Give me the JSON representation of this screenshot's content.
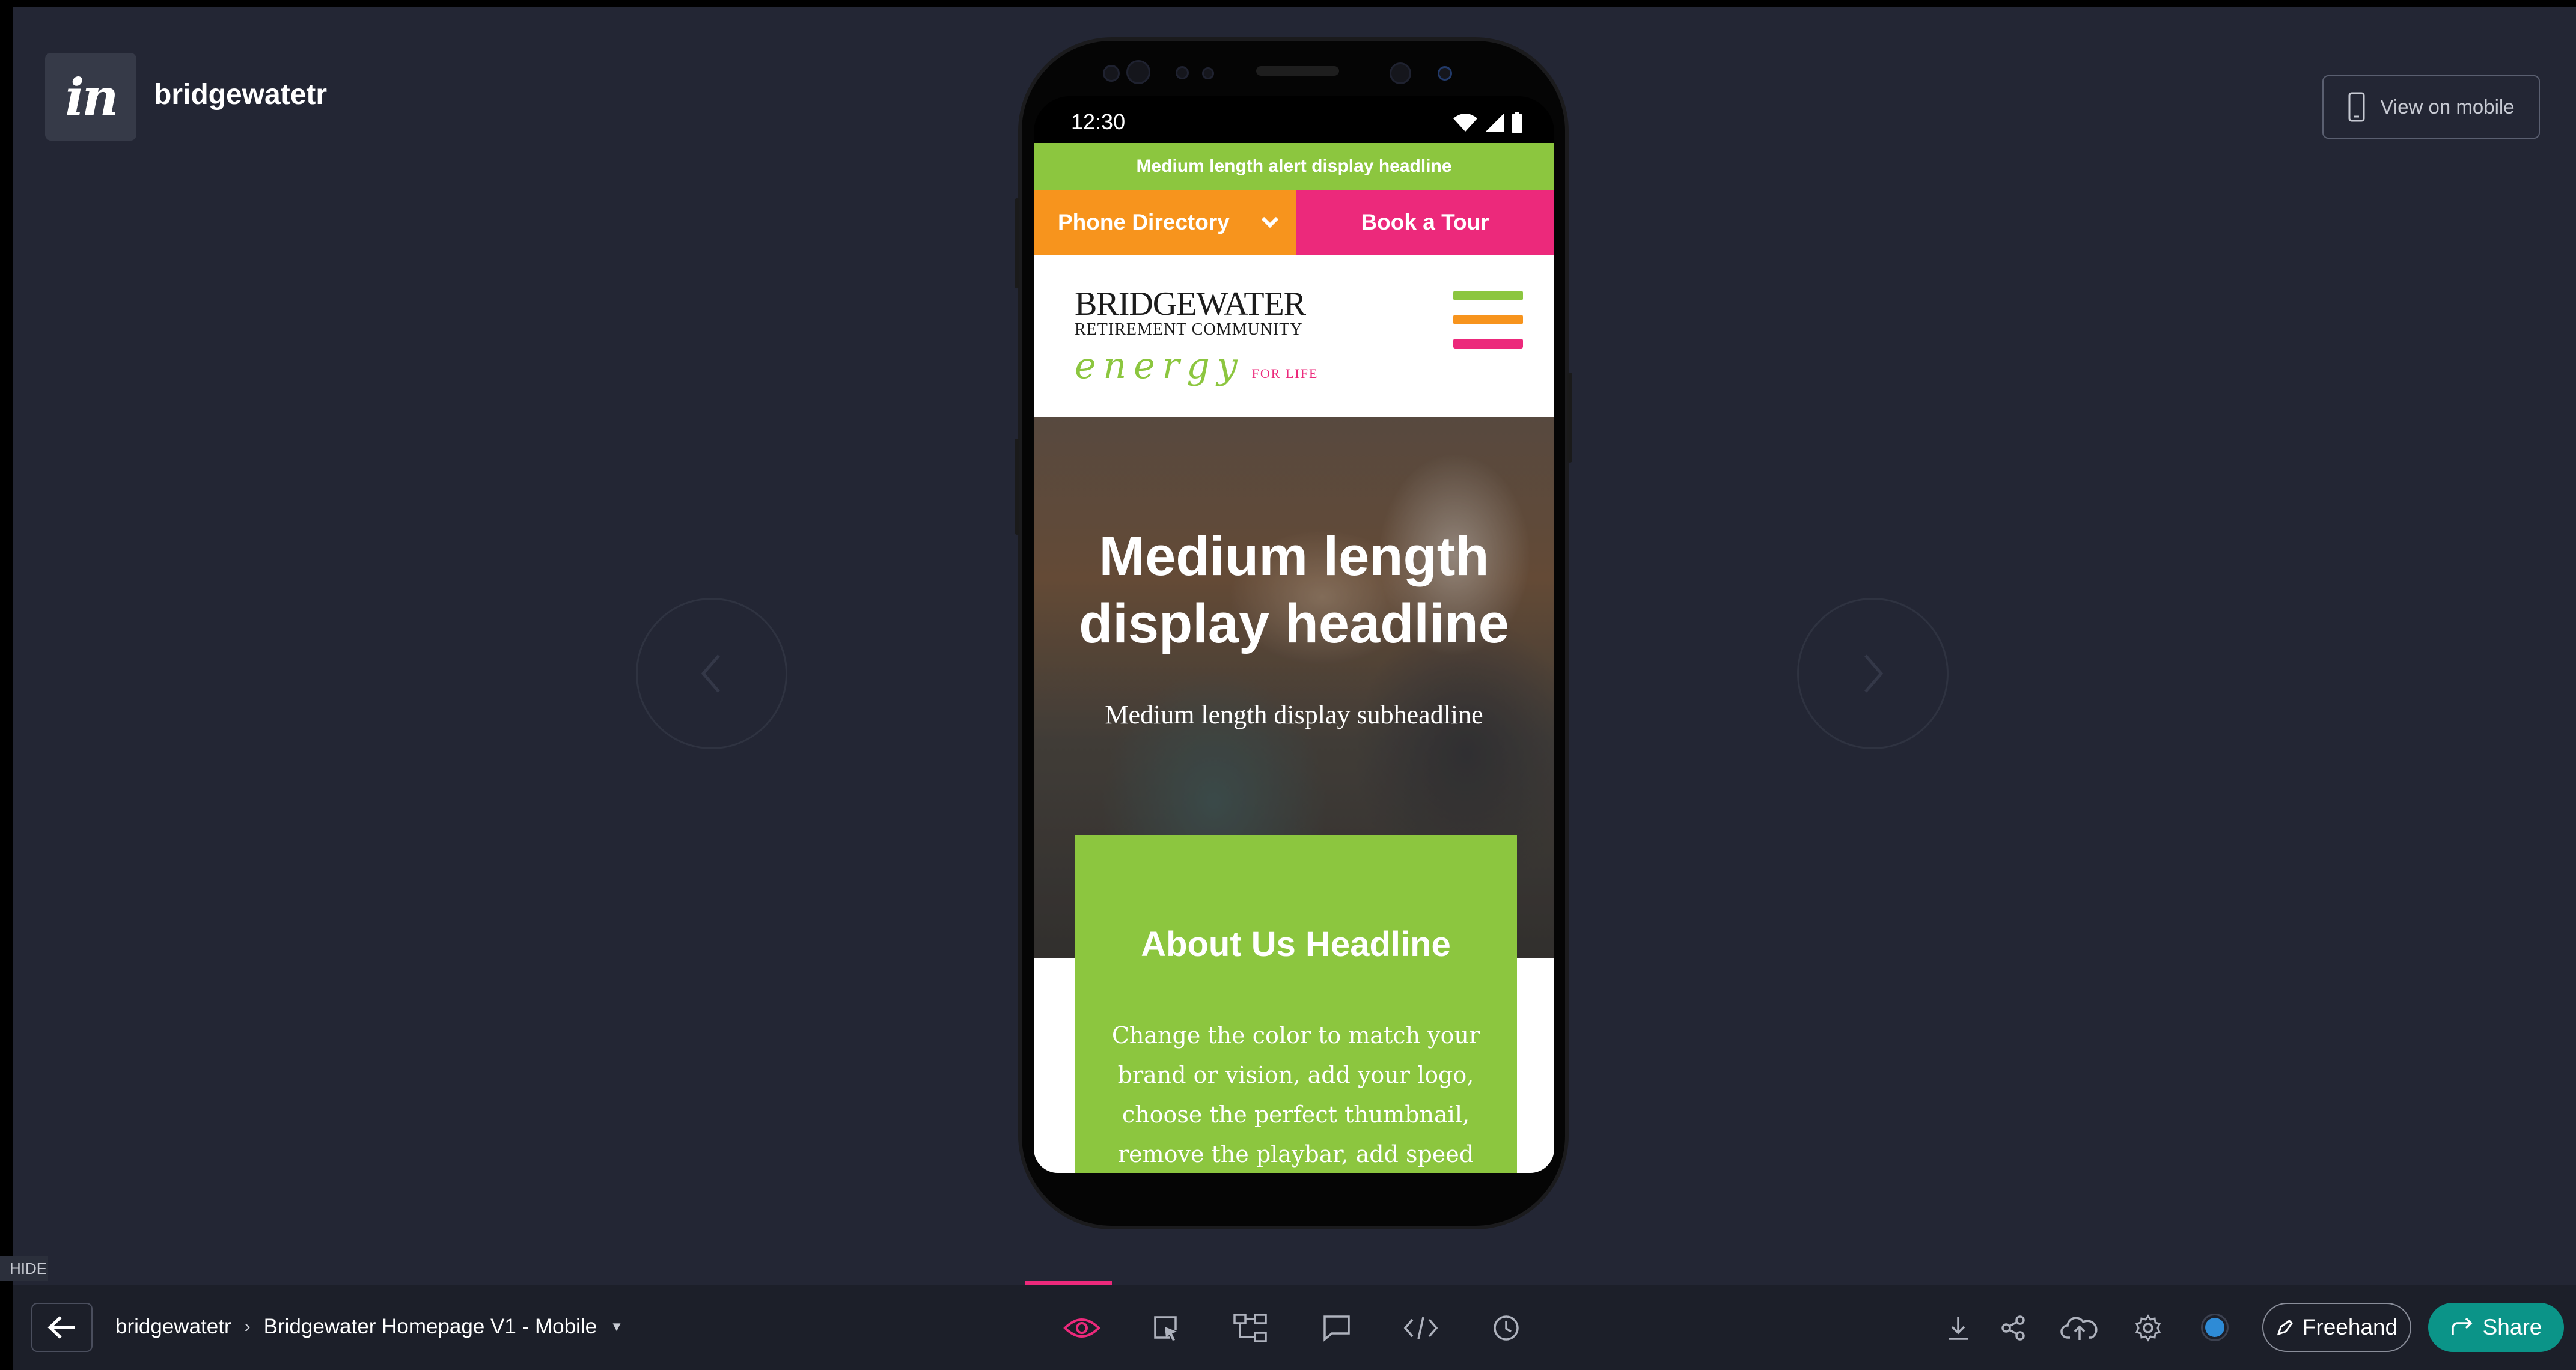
{
  "app": {
    "project_name": "bridgewatetr",
    "logo_text": "in",
    "view_on_mobile_label": "View on mobile",
    "hide_label": "HIDE"
  },
  "breadcrumb": {
    "project": "bridgewatetr",
    "screen": "Bridgewater Homepage V1 - Mobile"
  },
  "toolbar": {
    "tools": [
      "preview-icon",
      "inspect-icon",
      "flow-icon",
      "comment-icon",
      "code-icon",
      "history-icon"
    ],
    "active_tool": "preview-icon",
    "freehand_label": "Freehand",
    "share_label": "Share",
    "accent_color": "#ec297b",
    "share_color": "#0b9488"
  },
  "phone": {
    "status_time": "12:30",
    "status_icons": [
      "wifi-icon",
      "signal-icon",
      "battery-icon"
    ]
  },
  "site": {
    "alert": "Medium length alert display headline",
    "phone_directory": "Phone Directory",
    "book_tour": "Book a Tour",
    "brand_line1": "BRIDGEWATER",
    "brand_line2": "RETIREMENT COMMUNITY",
    "brand_tagline": "energy",
    "brand_tagline_suffix": "FOR LIFE",
    "hero_title": "Medium length display headline",
    "hero_subtitle": "Medium length display subheadline",
    "about_title": "About Us Headline",
    "about_body": "Change the color to match your brand or vision, add your logo, choose the perfect thumbnail, remove the playbar, add speed",
    "colors": {
      "green": "#8cc63f",
      "orange": "#f7941d",
      "pink": "#ec297b"
    }
  }
}
